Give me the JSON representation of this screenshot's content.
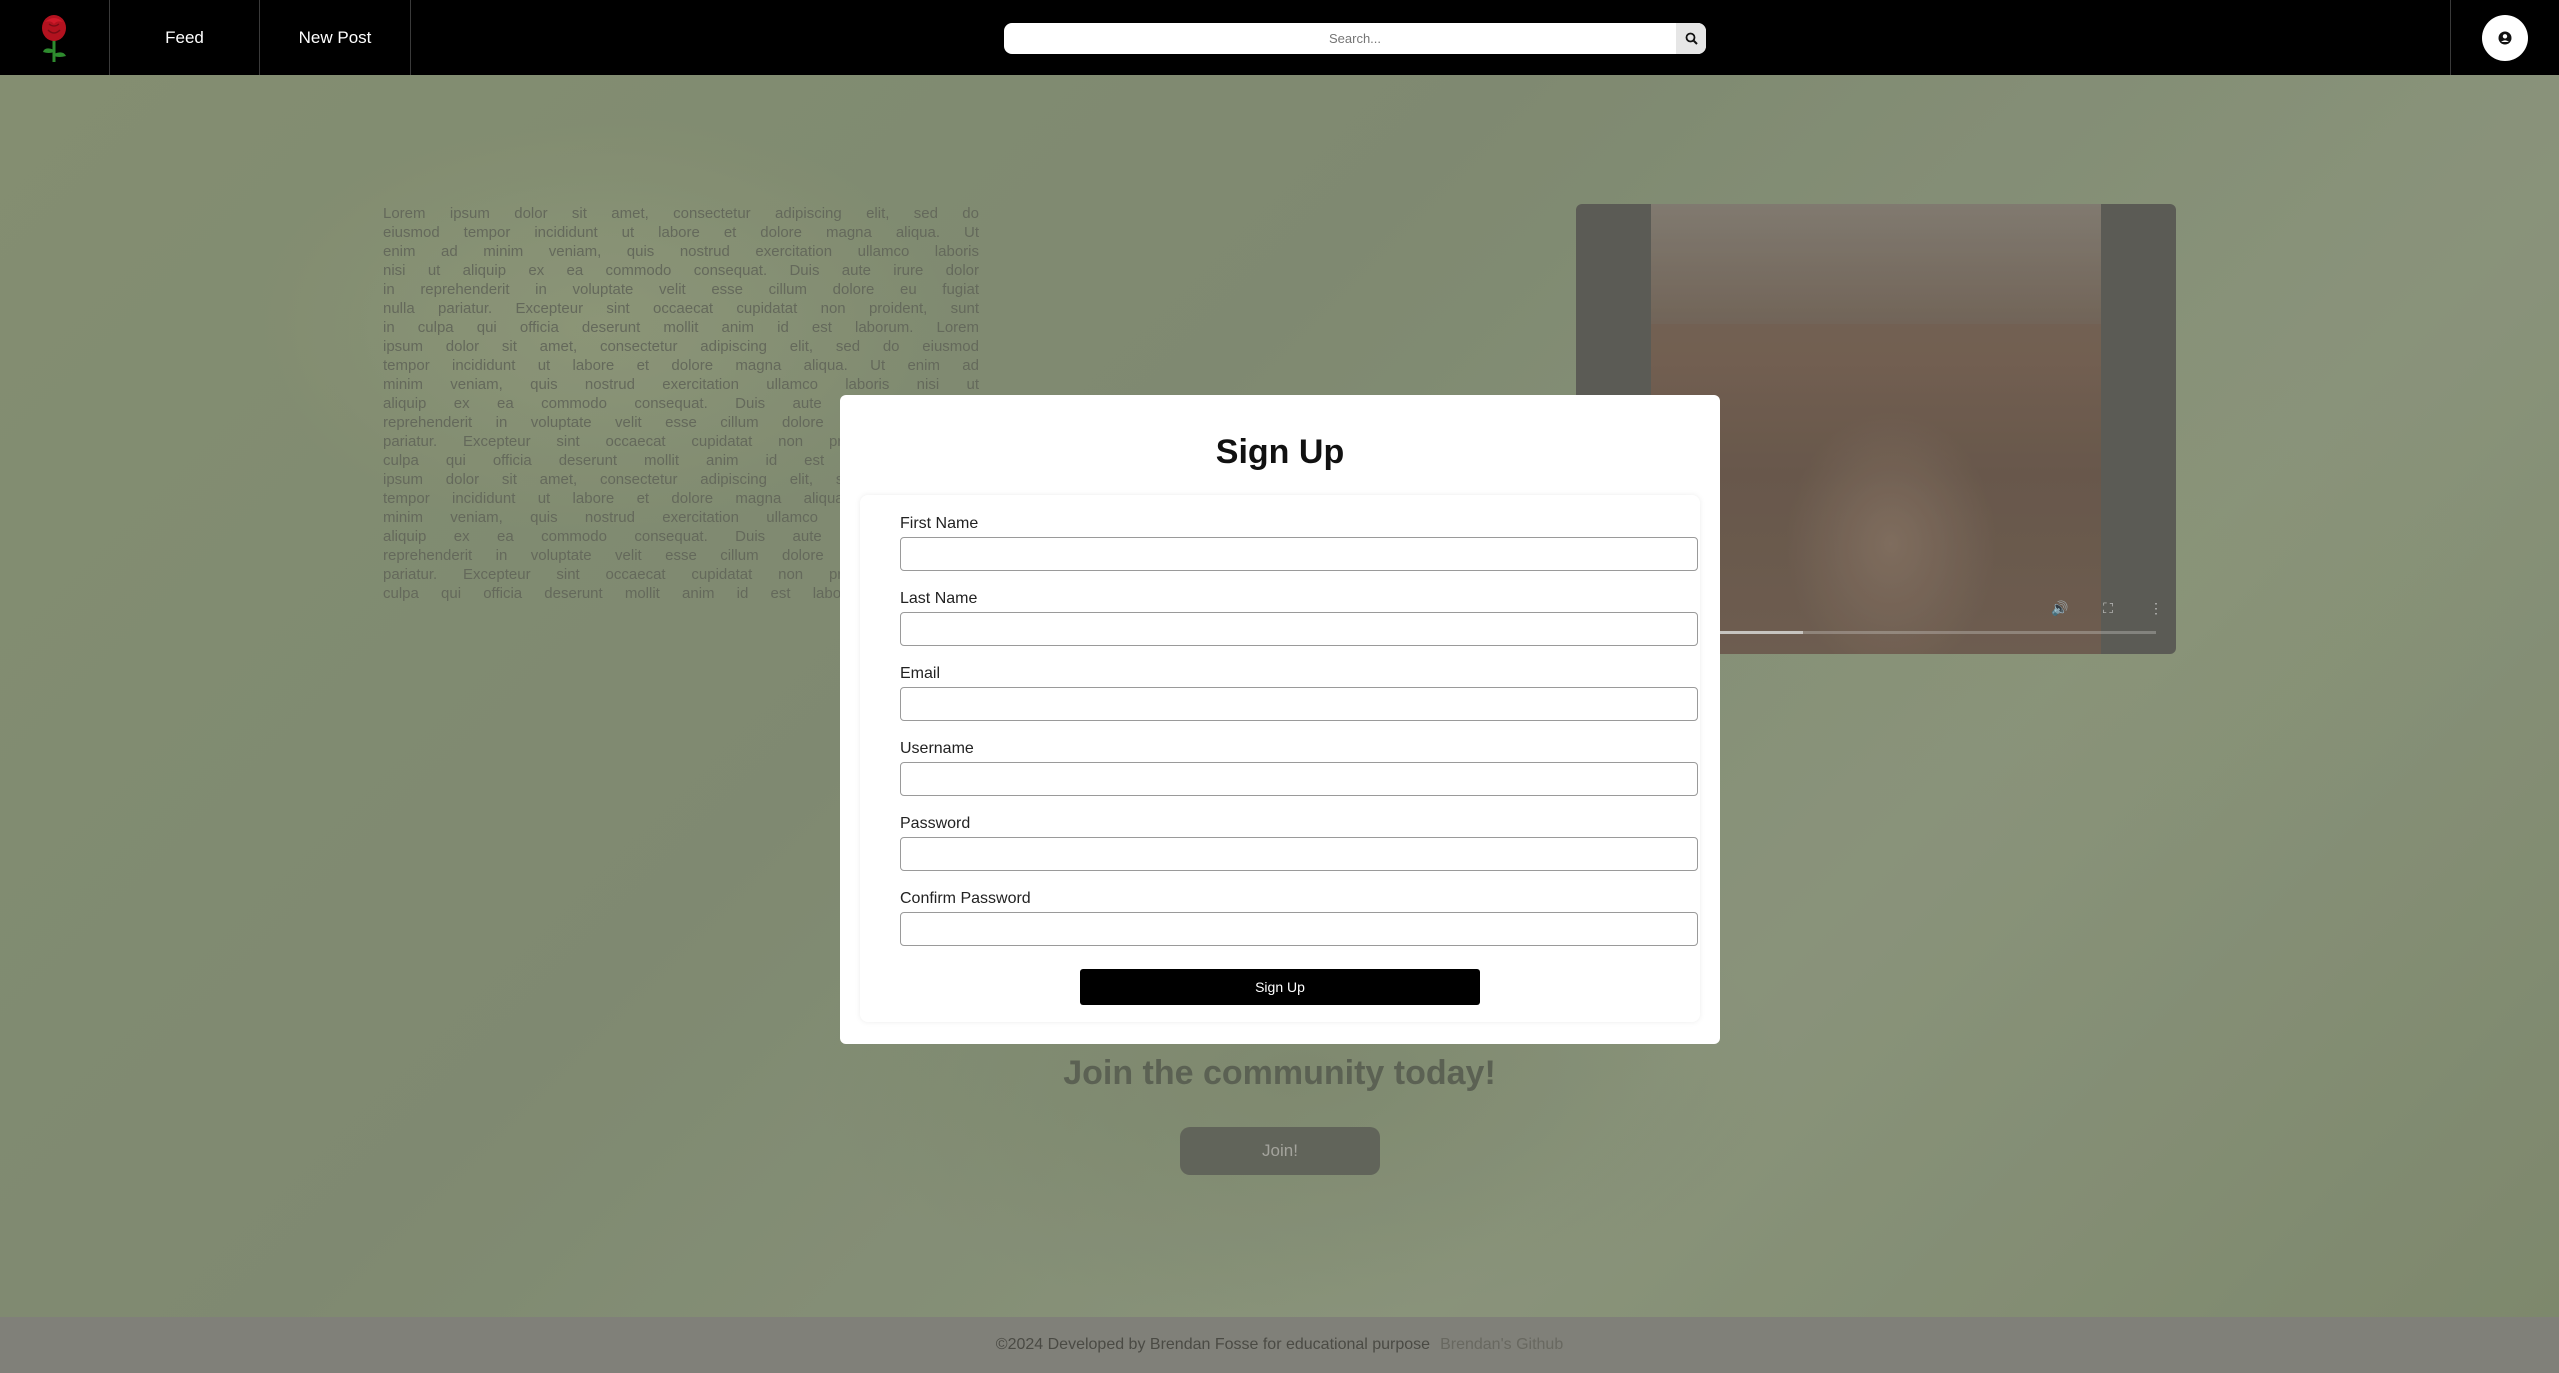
{
  "navbar": {
    "logo": "rose-logo",
    "links": [
      {
        "label": "Feed"
      },
      {
        "label": "New Post"
      }
    ],
    "search": {
      "placeholder": "Search...",
      "icon": "search-icon"
    },
    "user_icon": "user-icon"
  },
  "hero": {
    "lorem": "Lorem ipsum dolor sit amet, consectetur adipiscing elit, sed do eiusmod tempor incididunt ut labore et dolore magna aliqua. Ut enim ad minim veniam, quis nostrud exercitation ullamco laboris nisi ut aliquip ex ea commodo consequat. Duis aute irure dolor in reprehenderit in voluptate velit esse cillum dolore eu fugiat nulla pariatur. Excepteur sint occaecat cupidatat non proident, sunt in culpa qui officia deserunt mollit anim id est laborum. Lorem ipsum dolor sit amet, consectetur adipiscing elit, sed do eiusmod tempor incididunt ut labore et dolore magna aliqua. Ut enim ad minim veniam, quis nostrud exercitation ullamco laboris nisi ut aliquip ex ea commodo consequat. Duis aute irure dolor in reprehenderit in voluptate velit esse cillum dolore eu fugiat nulla pariatur. Excepteur sint occaecat cupidatat non proident, sunt in culpa qui officia deserunt mollit anim id est laborum. Lorem ipsum dolor sit amet, consectetur adipiscing elit, sed do eiusmod tempor incididunt ut labore et dolore magna aliqua. Ut enim ad minim veniam, quis nostrud exercitation ullamco laboris nisi ut aliquip ex ea commodo consequat. Duis aute irure dolor in reprehenderit in voluptate velit esse cillum dolore eu fugiat nulla pariatur. Excepteur sint occaecat cupidatat non proident, sunt in culpa qui officia deserunt mollit anim id est laborum.",
    "video": {
      "progress": 0.37,
      "controls": [
        "volume-icon",
        "fullscreen-icon",
        "more-vertical-icon"
      ]
    },
    "join_title": "Join the community today!",
    "join_button": "Join!"
  },
  "modal": {
    "title": "Sign Up",
    "fields": [
      {
        "label": "First Name",
        "value": ""
      },
      {
        "label": "Last Name",
        "value": ""
      },
      {
        "label": "Email",
        "value": ""
      },
      {
        "label": "Username",
        "value": ""
      },
      {
        "label": "Password",
        "value": ""
      },
      {
        "label": "Confirm Password",
        "value": ""
      }
    ],
    "submit": "Sign Up"
  },
  "footer": {
    "text": "©2024 Developed by Brendan Fosse for educational purpose",
    "link": "Brendan's Github"
  },
  "colors": {
    "navbar_bg": "#000000",
    "submit_bg": "#000000",
    "hero_bg": "#8d9a78",
    "footer_bg": "#8c8c84"
  }
}
